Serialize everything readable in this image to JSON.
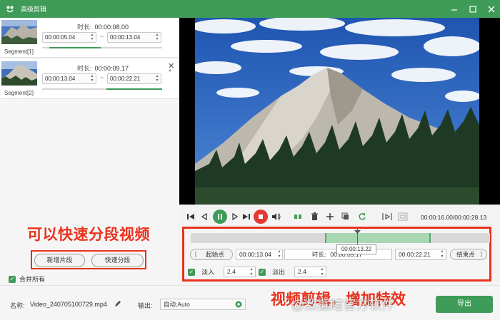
{
  "app": {
    "title": "高级剪辑",
    "colors": {
      "accent": "#3f9b58",
      "annotation": "#e8321e",
      "selection": "#a8d7b1"
    }
  },
  "segments": [
    {
      "label": "Segment[1]",
      "duration_label": "时长:",
      "duration": "00:00:08.00",
      "start": "00:00:05.04",
      "end": "00:00:13.04"
    },
    {
      "label": "Segment[2]",
      "duration_label": "时长:",
      "duration": "00:00:09.17",
      "start": "00:00:13.04",
      "end": "00:00:22.21"
    }
  ],
  "segment_separator": "~",
  "left_annotation": "可以快速分段视频",
  "buttons": {
    "new_segment": "新增片段",
    "quick_split": "快速分段"
  },
  "merge": {
    "label": "合并所有",
    "checked": true
  },
  "transport": {
    "time_readout": "00:00:16.00/00:00:28.13"
  },
  "trim": {
    "start_button": "起始点",
    "start_time": "00:00:13.04",
    "duration_label": "时长:",
    "duration_value": "00:00:09.17",
    "end_time": "00:00:22.21",
    "end_button": "结束点",
    "playhead_tooltip": "00:00:13.22",
    "bracket_open": "[",
    "bracket_close": "]",
    "fade_in_label": "淡入",
    "fade_in_value": "2.4",
    "fade_out_label": "淡出",
    "fade_out_value": "2.4"
  },
  "footer": {
    "name_label": "名称:",
    "file_name": "Video_240705100729.mp4",
    "output_label": "输出:",
    "output_value": "自动;Auto",
    "export_label": "导出"
  },
  "bottom_annotation": "视频剪辑，增加特效",
  "watermark": "@数据蛙官方软件"
}
